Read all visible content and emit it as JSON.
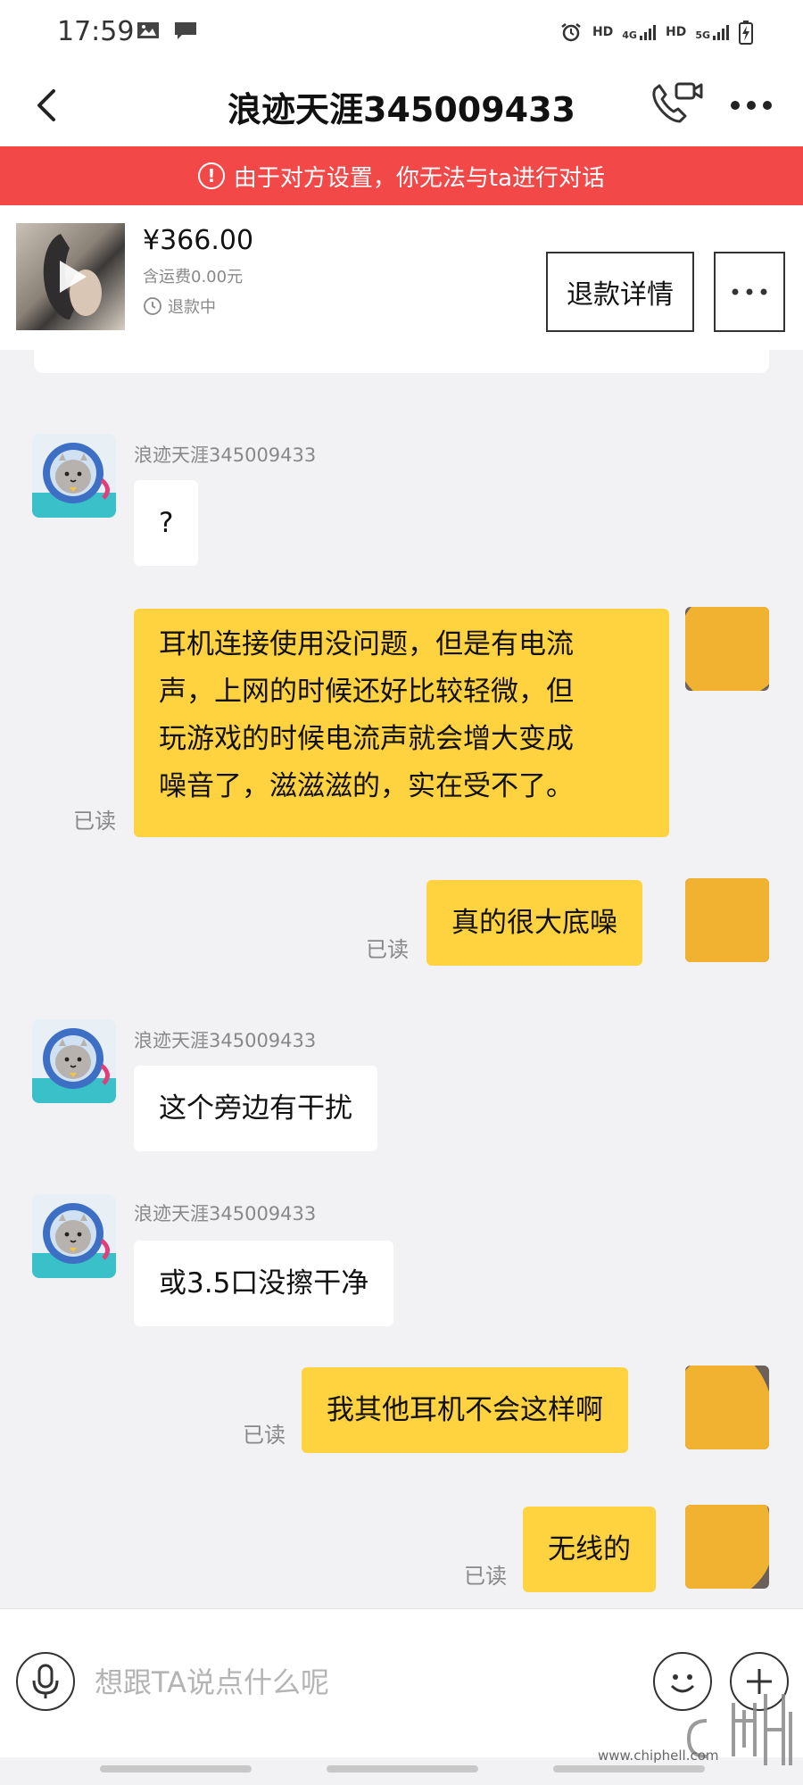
{
  "status_bar": {
    "time": "17:59",
    "left_icons": [
      "image-icon",
      "chat-icon"
    ],
    "right_icons": [
      "alarm-icon",
      "hd-icon",
      "4g-signal-icon",
      "hd-icon",
      "5g-signal-icon",
      "battery-charging-icon"
    ],
    "labels": {
      "hd1": "HD",
      "net1": "4G",
      "hd2": "HD",
      "net2": "5G"
    }
  },
  "header": {
    "title": "浪迹天涯345009433",
    "icons": [
      "back-arrow-icon",
      "phone-video-icon",
      "more-dots-icon"
    ]
  },
  "banner": {
    "text": "由于对方设置，你无法与ta进行对话",
    "icon": "warning-circle-icon",
    "color": "#f24848"
  },
  "product": {
    "price": "¥366.00",
    "shipping": "含运费0.00元",
    "status": "退款中",
    "refund_button": "退款详情"
  },
  "messages": [
    {
      "side": "in",
      "sender": "浪迹天涯345009433",
      "text": "?"
    },
    {
      "side": "out",
      "read": "已读",
      "lines": [
        "耳机连接使用没问题，但是有电流",
        "声，上网的时候还好比较轻微，但",
        "玩游戏的时候电流声就会增大变成",
        "噪音了，滋滋滋的，实在受不了。"
      ]
    },
    {
      "side": "out",
      "read": "已读",
      "text": "真的很大底噪"
    },
    {
      "side": "in",
      "sender": "浪迹天涯345009433",
      "text": "这个旁边有干扰"
    },
    {
      "side": "in",
      "sender": "浪迹天涯345009433",
      "text": "或3.5口没擦干净"
    },
    {
      "side": "out",
      "read": "已读",
      "text": "我其他耳机不会这样啊"
    },
    {
      "side": "out",
      "read": "已读",
      "text": "无线的"
    }
  ],
  "input_bar": {
    "placeholder": "想跟TA说点什么呢",
    "icons": [
      "microphone-icon",
      "emoji-icon",
      "plus-icon"
    ]
  },
  "watermark": {
    "text": "www.chiphell.com"
  },
  "colors": {
    "accent_yellow": "#ffd23f",
    "banner_red": "#f24848",
    "background": "#f2f2f4"
  }
}
